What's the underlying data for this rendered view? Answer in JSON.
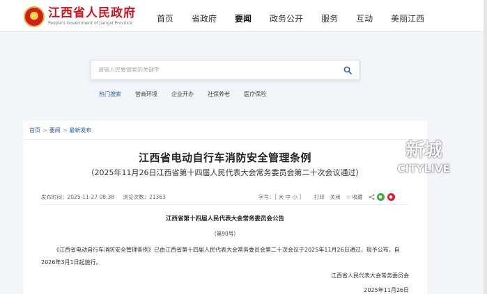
{
  "header": {
    "logo_cn": "江西省人民政府",
    "logo_en": "People's Government of Jiangxi Province",
    "nav": [
      "首页",
      "省政府",
      "要闻",
      "政务公开",
      "服务",
      "互动",
      "美丽江西"
    ],
    "active_nav": "要闻"
  },
  "search": {
    "placeholder": "请输入您要搜索的关键字",
    "icon": "search-icon"
  },
  "hotwords": {
    "label": "热门搜索",
    "items": [
      "营商环境",
      "企业开办",
      "社保养老",
      "医疗保险"
    ]
  },
  "breadcrumb": [
    "首页",
    "要闻",
    "最新发布"
  ],
  "article": {
    "title": "江西省电动自行车消防安全管理条例",
    "subtitle": "（2025年11月26日江西省第十四届人民代表大会常务委员会第二十次会议通过）",
    "publish_time": "发布时间：2025-11-27 08:38",
    "views": "浏览次数：21363",
    "font_size_label": "字号：［ 大  中  小 ］",
    "print": "打印",
    "close": "关闭",
    "favorite": "收藏",
    "notice_title": "江西省第十四届人民代表大会常务委员会公告",
    "notice_number": "（第90号）",
    "body": "《江西省电动自行车消防安全管理条例》已由江西省第十四届人民代表大会常务委员会第二十次会议于2025年11月26日通过，现予公布，自2026年3月1日起施行。",
    "signature": "江西省人民代表大会常务委员会",
    "signature_date": "2025年11月26日"
  },
  "watermark": {
    "cn": "新城",
    "en": "CITYLIVE"
  },
  "colors": {
    "brand_red": "#c9151e",
    "link_blue": "#2a61b0",
    "page_bg": "#f3f5f9"
  }
}
